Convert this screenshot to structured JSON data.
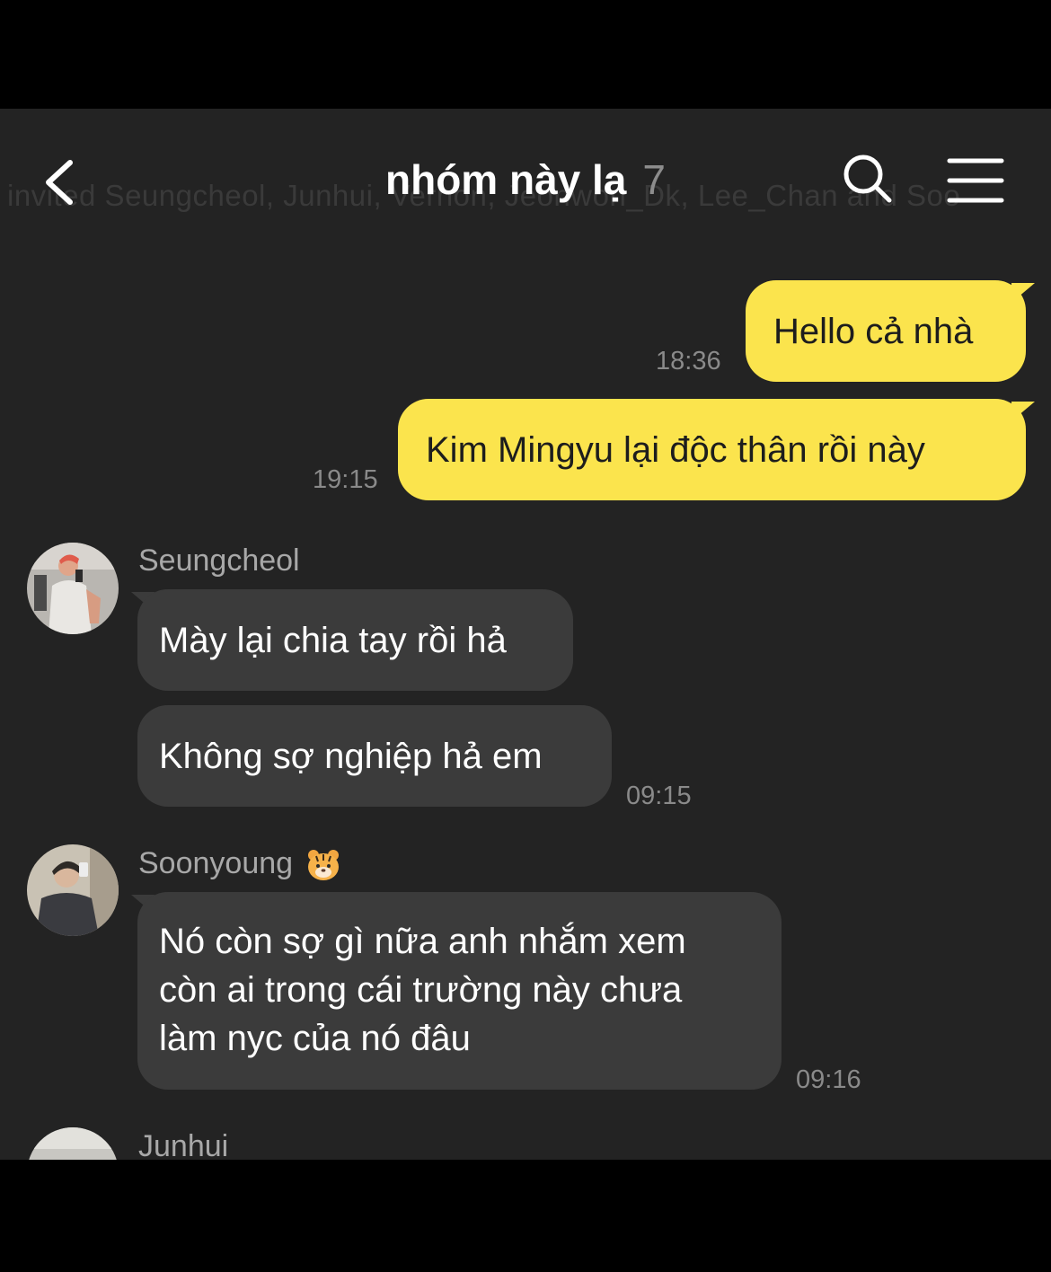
{
  "header": {
    "title": "nhóm này lạ",
    "member_count": "7",
    "invite_banner": "invited Seungcheol, Junhui, Vernon, Jeonwon_Dk, Lee_Chan and Soo",
    "icons": [
      "back-chevron-icon",
      "search-icon",
      "menu-icon"
    ]
  },
  "messages": {
    "mine": [
      {
        "text": "Hello cả nhà",
        "time": "18:36"
      },
      {
        "text": "Kim Mingyu lại độc thân rồi này",
        "time": "19:15"
      }
    ],
    "seungcheol": {
      "name": "Seungcheol",
      "texts": [
        "Mày lại chia tay rồi hả",
        "Không sợ nghiệp hả em"
      ],
      "time": "09:15"
    },
    "soonyoung": {
      "name": "Soonyoung",
      "lines": [
        "Nó còn sợ gì nữa anh nhắm xem",
        "còn ai trong cái trường này chưa",
        "làm nyc của nó đâu"
      ],
      "time": "09:16"
    },
    "junhui": {
      "name": "Junhui"
    }
  },
  "colors": {
    "background": "#232323",
    "my_bubble": "#fbe44d",
    "their_bubble": "#3b3b3b"
  }
}
